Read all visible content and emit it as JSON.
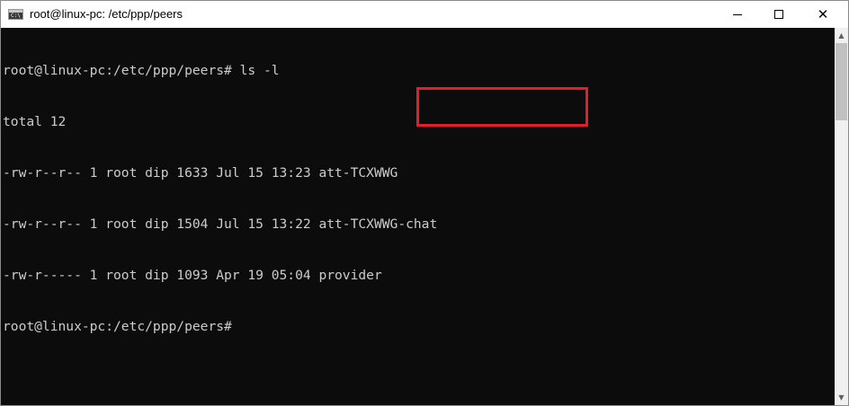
{
  "window": {
    "title": "root@linux-pc: /etc/ppp/peers",
    "app_icon_glyph": "C:\\"
  },
  "title_buttons": {
    "close_glyph": "✕"
  },
  "terminal": {
    "lines": [
      {
        "prefix": "root@linux-pc:/etc/ppp/peers# ls -l",
        "name": ""
      },
      {
        "prefix": "total 12",
        "name": ""
      },
      {
        "prefix": "-rw-r--r-- 1 root dip 1633 Jul 15 13:23 ",
        "name": "att-TCXWWG"
      },
      {
        "prefix": "-rw-r--r-- 1 root dip 1504 Jul 15 13:22 ",
        "name": "att-TCXWWG-chat"
      },
      {
        "prefix": "-rw-r----- 1 root dip 1093 Apr 19 05:04 ",
        "name": "provider"
      },
      {
        "prefix": "root@linux-pc:/etc/ppp/peers#",
        "name": ""
      }
    ]
  },
  "scrollbar": {
    "up_glyph": "▲",
    "down_glyph": "▼"
  },
  "colors": {
    "terminal_bg": "#0c0c0c",
    "terminal_text": "#cccccc",
    "highlight": "#e21e2a"
  }
}
